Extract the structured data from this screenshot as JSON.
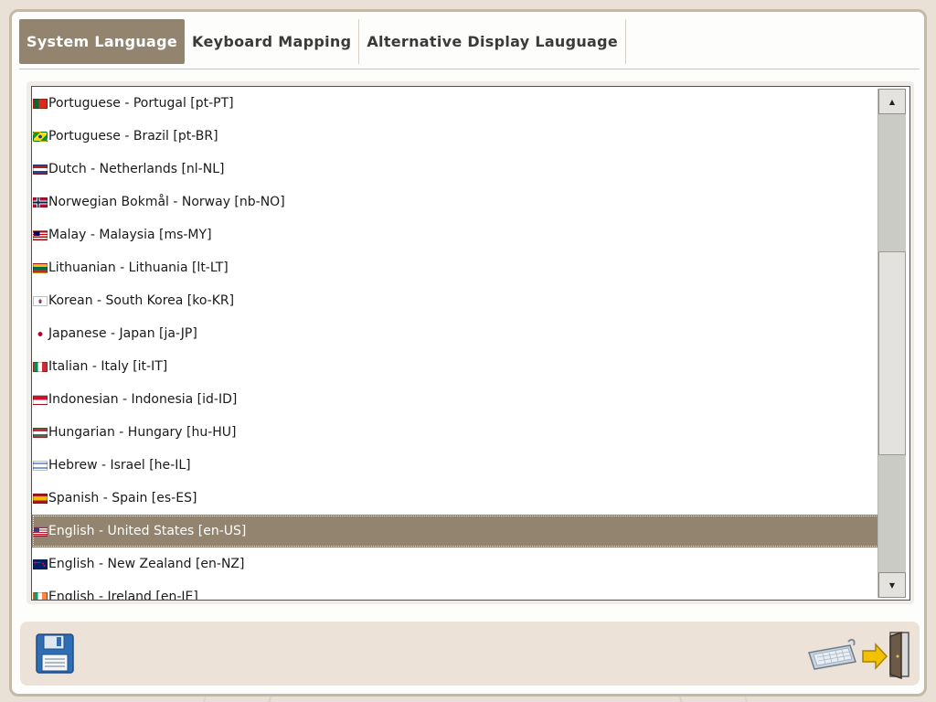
{
  "tabs": [
    {
      "label": "System Language",
      "active": true
    },
    {
      "label": "Keyboard Mapping",
      "active": false
    },
    {
      "label": "Alternative Display Lauguage",
      "active": false
    }
  ],
  "languages": [
    {
      "label": "Portuguese - Portugal [pt-PT]",
      "flag": "flag-pt"
    },
    {
      "label": "Portuguese - Brazil [pt-BR]",
      "flag": "flag-br"
    },
    {
      "label": "Dutch - Netherlands [nl-NL]",
      "flag": "flag-nl"
    },
    {
      "label": "Norwegian Bokmål - Norway [nb-NO]",
      "flag": "flag-no"
    },
    {
      "label": "Malay - Malaysia [ms-MY]",
      "flag": "flag-my"
    },
    {
      "label": "Lithuanian - Lithuania [lt-LT]",
      "flag": "flag-lt"
    },
    {
      "label": "Korean - South Korea [ko-KR]",
      "flag": "flag-kr"
    },
    {
      "label": "Japanese - Japan [ja-JP]",
      "flag": "flag-jp"
    },
    {
      "label": "Italian - Italy [it-IT]",
      "flag": "flag-it"
    },
    {
      "label": "Indonesian - Indonesia [id-ID]",
      "flag": "flag-id"
    },
    {
      "label": "Hungarian - Hungary [hu-HU]",
      "flag": "flag-hu"
    },
    {
      "label": "Hebrew - Israel [he-IL]",
      "flag": "flag-il"
    },
    {
      "label": "Spanish - Spain [es-ES]",
      "flag": "flag-es"
    },
    {
      "label": "English - United States [en-US]",
      "flag": "flag-us",
      "selected": true
    },
    {
      "label": "English - New Zealand [en-NZ]",
      "flag": "flag-nz"
    },
    {
      "label": "English - Ireland [en-IE]",
      "flag": "flag-ie"
    }
  ],
  "footer": {
    "save_icon": "floppy-disk-icon",
    "keyboard_icon": "keyboard-icon",
    "exit_icon": "exit-door-icon"
  },
  "colors": {
    "accent": "#938470",
    "footer_bg": "#ede2d8"
  }
}
